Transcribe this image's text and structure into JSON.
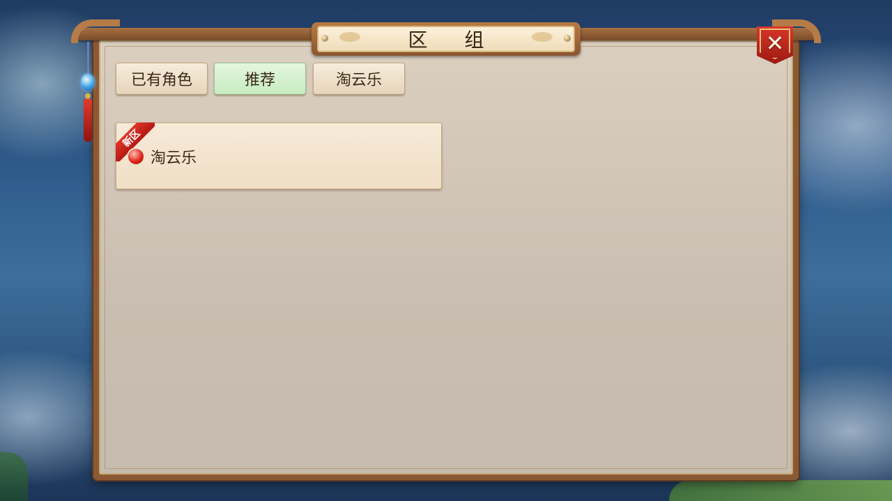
{
  "dialog": {
    "title": "区 组",
    "close_icon": "close-icon"
  },
  "tabs": [
    {
      "label": "已有角色",
      "active": false
    },
    {
      "label": "推荐",
      "active": true
    },
    {
      "label": "淘云乐",
      "active": false
    }
  ],
  "servers": [
    {
      "name": "淘云乐",
      "badge": "新区",
      "status": "red"
    }
  ],
  "colors": {
    "active_tab": "#c8ecc3",
    "status_red": "#e2261c",
    "ribbon_red": "#d8362a",
    "frame_brown": "#8a5a35"
  }
}
